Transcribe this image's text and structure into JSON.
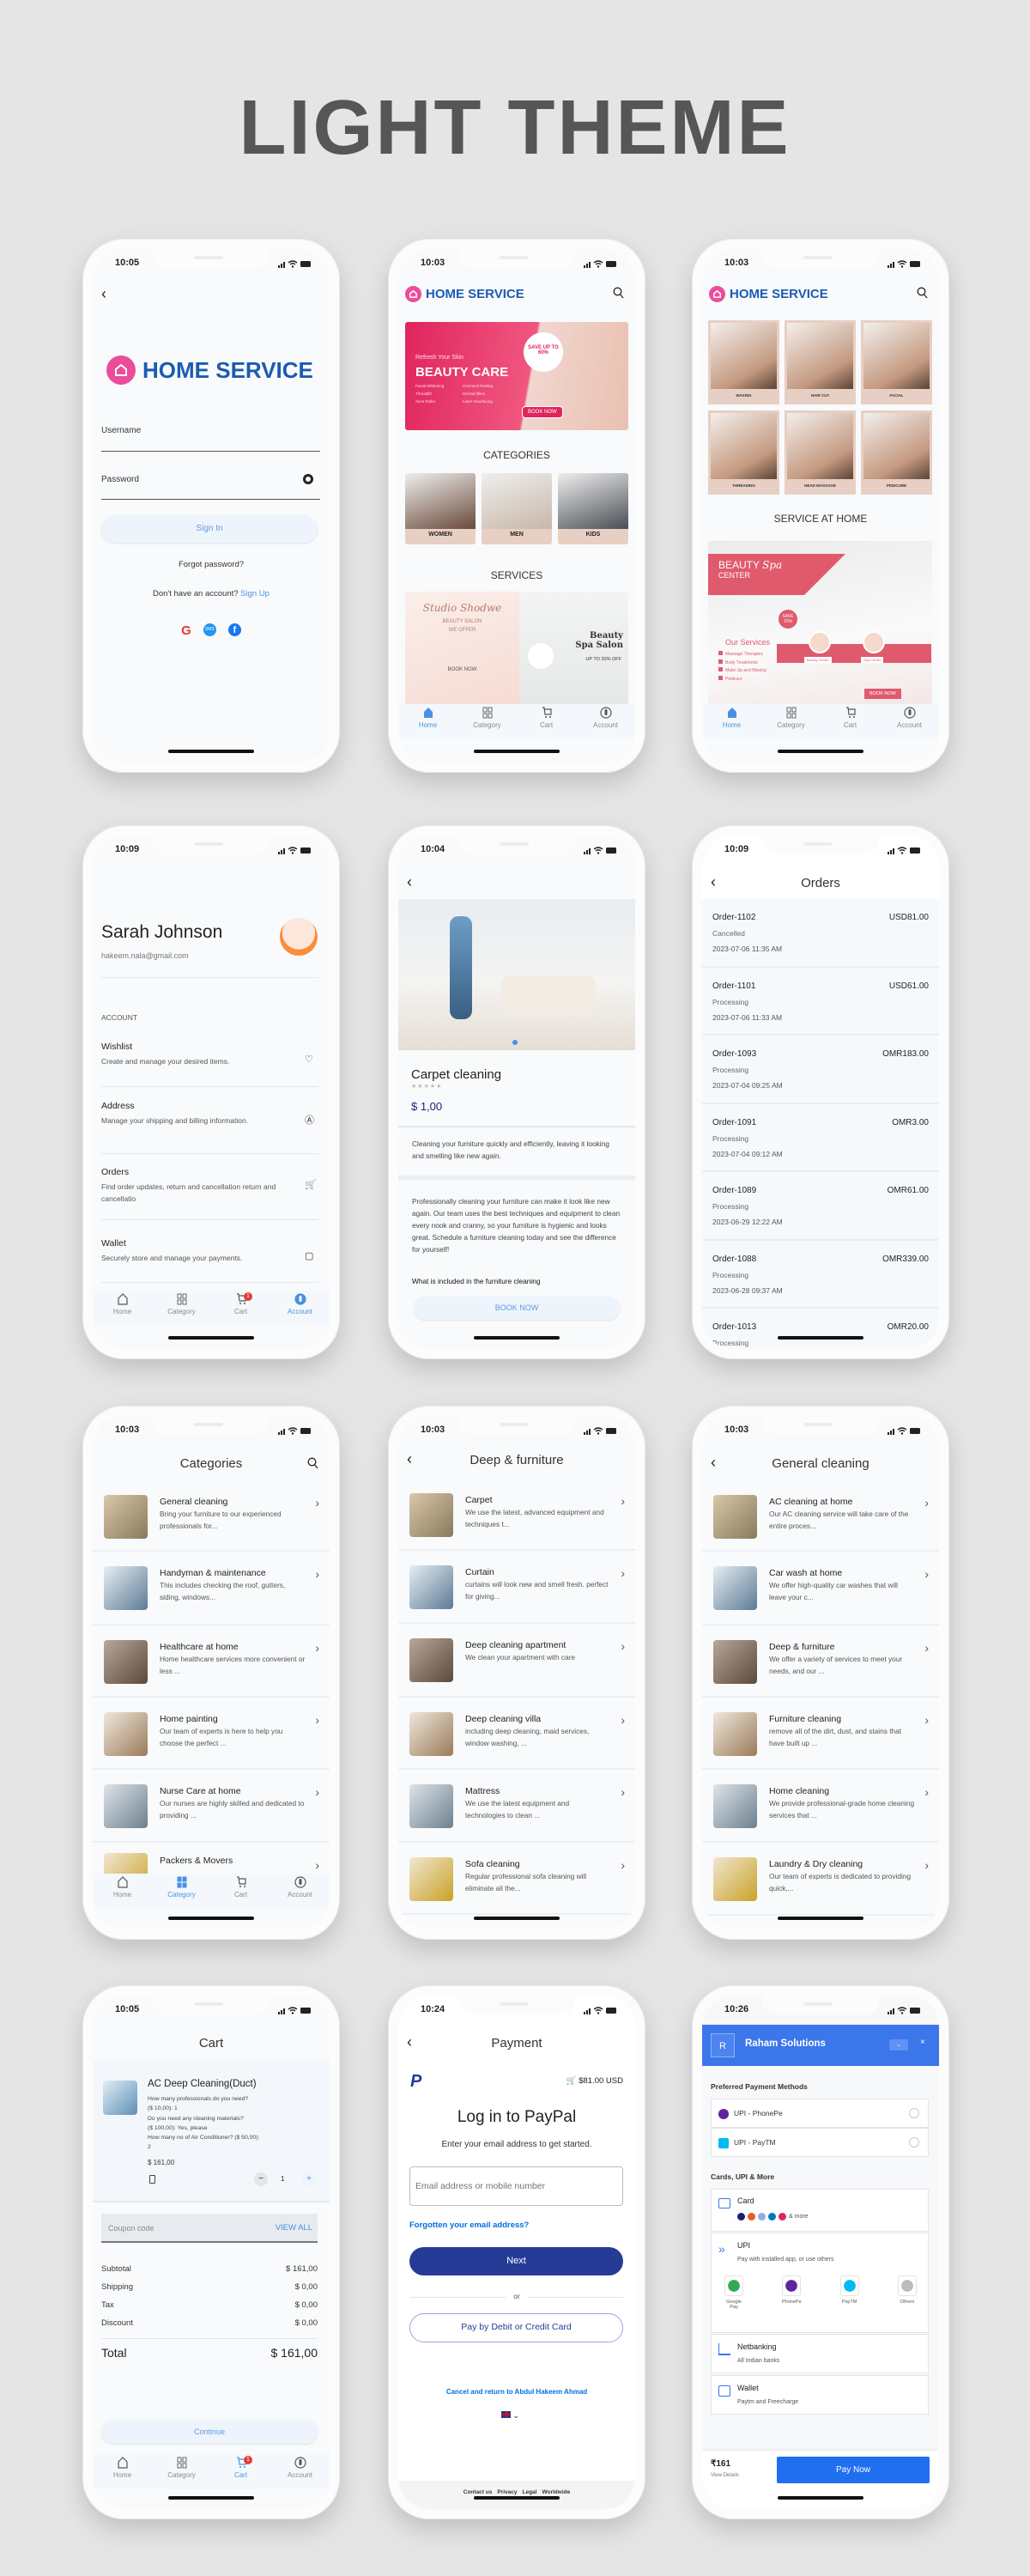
{
  "page_title": "LIGHT THEME",
  "colors": {
    "brand_blue": "#1c5bb0",
    "brand_pink": "#ec4d9a",
    "accent": "#4a90e2",
    "paypal_navy": "#253b95",
    "razorpay_blue": "#3b76ea",
    "category_tile": "#e8cfc4"
  },
  "tabbar": {
    "items": [
      {
        "label": "Home",
        "icon": "home-icon"
      },
      {
        "label": "Category",
        "icon": "grid-icon"
      },
      {
        "label": "Cart",
        "icon": "cart-icon"
      },
      {
        "label": "Account",
        "icon": "account-icon"
      }
    ],
    "cart_badge": "1"
  },
  "login": {
    "time": "10:05",
    "brand": "HOME SERVICE",
    "username_label": "Username",
    "password_label": "Password",
    "sign_in": "Sign In",
    "forgot": "Forgot password?",
    "no_account": "Don't have an account?",
    "sign_up": "Sign Up",
    "social": [
      "google-icon",
      "sms-icon",
      "facebook-icon"
    ]
  },
  "home": {
    "time": "10:03",
    "brand": "HOME SERVICE",
    "active_tab": 0,
    "banner": {
      "kicker": "Refresh Your Skin",
      "title": "BEAUTY CARE",
      "badge": "SAVE UP TO 60%",
      "cta": "BOOK NOW",
      "bullets": [
        "Facial Whitening",
        "Chemical Peeling",
        "Threadlift",
        "Dermal fillers",
        "Acne Roller",
        "Laser resurfacing"
      ]
    },
    "categories_heading": "CATEGORIES",
    "categories": [
      "WOMEN",
      "MEN",
      "KIDS"
    ],
    "services_heading": "SERVICES",
    "service_cards": [
      {
        "script": "Studio Shodwe",
        "title": "BEAUTY SALON",
        "sub": "WE OFFER",
        "cta": "BOOK NOW"
      },
      {
        "title": "Beauty Spa Salon",
        "sub": "UP TO 20% OFF"
      }
    ]
  },
  "home2": {
    "time": "10:03",
    "brand": "HOME SERVICE",
    "active_tab": 0,
    "grid": [
      "WAXING",
      "HAIR CUT",
      "FACIAL",
      "THREADING",
      "HEAD MASSAGE",
      "PEDICURE"
    ],
    "section_heading": "SERVICE AT HOME",
    "banner": {
      "title": "BEAUTY",
      "title2": "CENTER",
      "script": "Spa",
      "badge": "SAVE 15%",
      "services_heading": "Our Services",
      "services": [
        "Massage Therapies",
        "Body Treatments",
        "Make Up and Waxing",
        "Pedicure"
      ],
      "tags": [
        "Beauty Center",
        "Spa Center"
      ],
      "cta": "BOOK NOW"
    }
  },
  "account": {
    "time": "10:09",
    "name": "Sarah Johnson",
    "email": "hakeem.nala@gmail.com",
    "section": "ACCOUNT",
    "active_tab": 3,
    "items": [
      {
        "title": "Wishlist",
        "desc": "Create and manage your desired items.",
        "icon": "heart-icon"
      },
      {
        "title": "Address",
        "desc": "Manage your shipping and billing information.",
        "icon": "navigation-icon"
      },
      {
        "title": "Orders",
        "desc": "Find order updates, return and cancellation return and cancellatio",
        "icon": "cart-icon"
      },
      {
        "title": "Wallet",
        "desc": "Securely store and manage your payments.",
        "icon": "wallet-icon"
      }
    ]
  },
  "detail": {
    "time": "10:04",
    "title": "Carpet cleaning",
    "rating": 0,
    "rating_max": 5,
    "price": "$ 1,00",
    "short_desc": "Cleaning your furniture quickly and efficiently, leaving it looking and smelling like new again.",
    "long_desc": "Professionally cleaning your furniture can make it look like new again. Our team uses the best techniques and equipment to clean every nook and cranny, so your furniture is hygienic and looks great. Schedule a furniture cleaning today and see the difference for yourself!",
    "included_heading": "What is included in the furniture cleaning",
    "cta": "BOOK NOW"
  },
  "orders": {
    "time": "10:09",
    "title": "Orders",
    "items": [
      {
        "id": "Order-1102",
        "amount": "USD81.00",
        "status": "Cancelled",
        "date": "2023-07-06  11:35 AM"
      },
      {
        "id": "Order-1101",
        "amount": "USD61.00",
        "status": "Processing",
        "date": "2023-07-06  11:33 AM"
      },
      {
        "id": "Order-1093",
        "amount": "OMR183.00",
        "status": "Processing",
        "date": "2023-07-04  09:25 AM"
      },
      {
        "id": "Order-1091",
        "amount": "OMR3.00",
        "status": "Processing",
        "date": "2023-07-04  09:12 AM"
      },
      {
        "id": "Order-1089",
        "amount": "OMR61.00",
        "status": "Processing",
        "date": "2023-06-29  12:22 AM"
      },
      {
        "id": "Order-1088",
        "amount": "OMR339.00",
        "status": "Processing",
        "date": "2023-06-28  09:37 AM"
      },
      {
        "id": "Order-1013",
        "amount": "OMR20.00",
        "status": "Processing",
        "date": ""
      }
    ]
  },
  "categories": {
    "time": "10:03",
    "title": "Categories",
    "active_tab": 1,
    "items": [
      {
        "title": "General cleaning",
        "desc": "Bring your furniture to our experienced professionals for..."
      },
      {
        "title": "Handyman & maintenance",
        "desc": "This includes checking the roof, gutters, siding, windows..."
      },
      {
        "title": "Healthcare at home",
        "desc": "Home healthcare services more convenient or less ..."
      },
      {
        "title": "Home painting",
        "desc": "Our team of experts is here to help you choose the perfect ..."
      },
      {
        "title": "Nurse Care at home",
        "desc": "Our nurses are highly skilled and dedicated to providing ..."
      },
      {
        "title": "Packers & Movers",
        "desc": ""
      }
    ]
  },
  "deep": {
    "time": "10:03",
    "title": "Deep & furniture",
    "items": [
      {
        "title": "Carpet",
        "desc": "We use the latest, advanced equipment and techniques t..."
      },
      {
        "title": "Curtain",
        "desc": "curtains will look new and smell fresh. perfect for giving..."
      },
      {
        "title": "Deep cleaning apartment",
        "desc": "We clean your apartment with care"
      },
      {
        "title": "Deep cleaning villa",
        "desc": "including deep cleaning, maid services, window washing, ..."
      },
      {
        "title": "Mattress",
        "desc": "We use the latest equipment and technologies to clean ..."
      },
      {
        "title": "Sofa cleaning",
        "desc": "Regular professional sofa cleaning will eliminate all the..."
      }
    ]
  },
  "general": {
    "time": "10:03",
    "title": "General cleaning",
    "items": [
      {
        "title": "AC cleaning at home",
        "desc": "Our AC cleaning service will take care of the entire proces..."
      },
      {
        "title": "Car wash at home",
        "desc": "We offer high-quality car washes that will leave your c..."
      },
      {
        "title": "Deep & furniture",
        "desc": "We offer a variety of services to meet your needs, and our ..."
      },
      {
        "title": "Furniture cleaning",
        "desc": "remove all of the dirt, dust, and stains that have built up ..."
      },
      {
        "title": "Home cleaning",
        "desc": "We provide professional-grade home cleaning services that ..."
      },
      {
        "title": "Laundry & Dry cleaning",
        "desc": "Our team of experts is dedicated to providing quick,..."
      }
    ]
  },
  "cart": {
    "time": "10:05",
    "title": "Cart",
    "active_tab": 2,
    "item": {
      "title": "AC Deep  Cleaning(Duct)",
      "options": [
        "How many professionals do you need?",
        "($ 10,00): 1",
        "Do you need any cleaning materials?",
        "($ 100,00): Yes, please",
        "How many no of Air Conditioner? ($ 50,00):",
        "2"
      ],
      "price": "$ 161,00",
      "quantity": "1"
    },
    "coupon_placeholder": "Coupon code",
    "view_all": "VIEW ALL",
    "summary": [
      {
        "label": "Subtotal",
        "value": "$ 161,00"
      },
      {
        "label": "Shipping",
        "value": "$ 0,00"
      },
      {
        "label": "Tax",
        "value": "$ 0,00"
      },
      {
        "label": "Discount",
        "value": "$ 0,00"
      }
    ],
    "total_label": "Total",
    "total_value": "$ 161,00",
    "continue": "Continue"
  },
  "payment": {
    "time": "10:24",
    "title": "Payment",
    "amount": "$81.00 USD",
    "heading": "Log in to PayPal",
    "subheading": "Enter your email address to get started.",
    "email_placeholder": "Email address or mobile number",
    "forgot": "Forgotten your email address?",
    "next": "Next",
    "or": "or",
    "card_button": "Pay by Debit or Credit Card",
    "cancel": "Cancel and return to Abdul Hakeem Ahmad",
    "footer": [
      "Contact us",
      "Privacy",
      "Legal",
      "Worldwide"
    ]
  },
  "razorpay": {
    "time": "10:26",
    "initial": "R",
    "merchant": "Raham Solutions",
    "preferred_heading": "Preferred Payment Methods",
    "preferred": [
      "UPI - PhonePe",
      "UPI - PayTM"
    ],
    "more_heading": "Cards, UPI & More",
    "card": {
      "title": "Card",
      "more": "& more"
    },
    "upi": {
      "title": "UPI",
      "sub": "Pay with installed app, or use others",
      "apps": [
        "Google Pay",
        "PhonePe",
        "PayTM",
        "Others"
      ]
    },
    "netbanking": {
      "title": "Netbanking",
      "sub": "All Indian banks"
    },
    "wallet": {
      "title": "Wallet",
      "sub": "Paytm and Freecharge"
    },
    "amount": "₹161",
    "view_details": "View Details",
    "pay_now": "Pay Now"
  }
}
